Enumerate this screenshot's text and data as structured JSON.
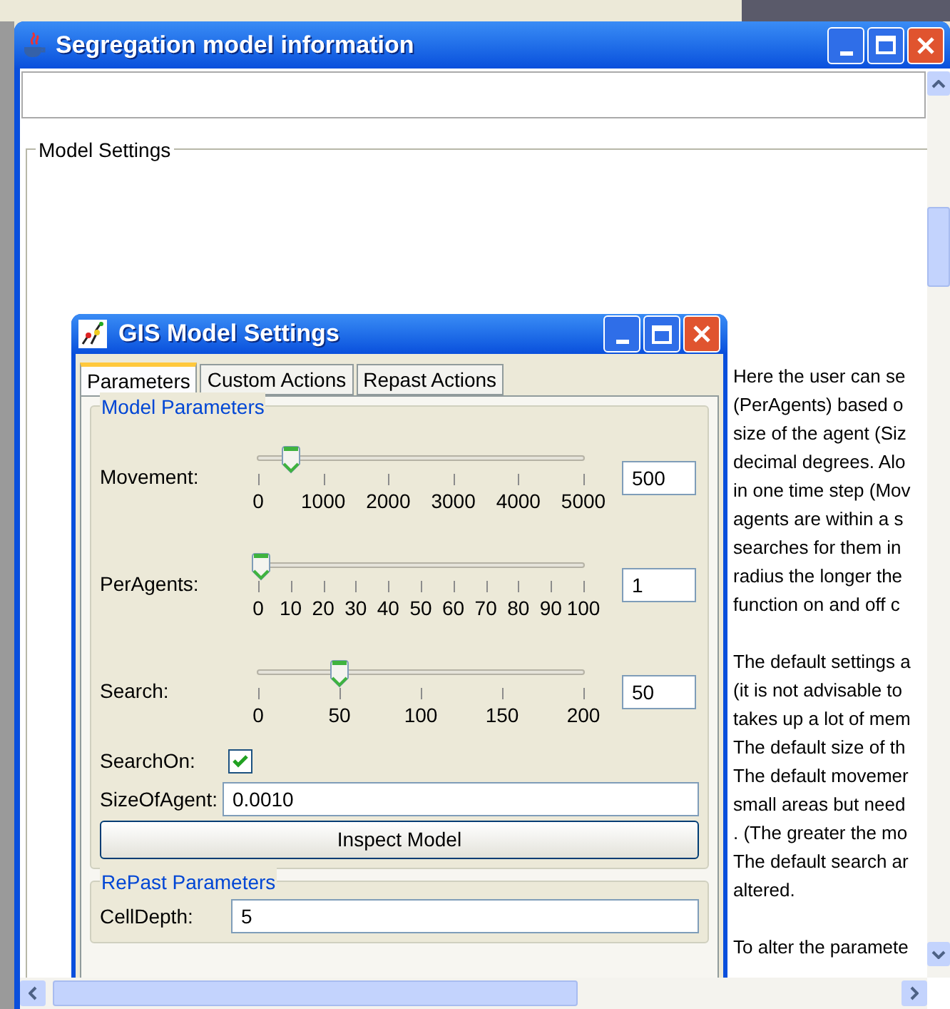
{
  "window": {
    "title": "Segregation model information"
  },
  "group": {
    "title": "Model Settings"
  },
  "dialog": {
    "title": "GIS Model Settings",
    "tabs": [
      {
        "label": "Parameters",
        "selected": true
      },
      {
        "label": "Custom Actions",
        "selected": false
      },
      {
        "label": "Repast Actions",
        "selected": false
      }
    ],
    "model_parameters": {
      "title": "Model Parameters",
      "sliders": [
        {
          "label": "Movement:",
          "level": 0.1,
          "value": "500",
          "ticks": [
            "0",
            "1000",
            "2000",
            "3000",
            "4000",
            "5000"
          ]
        },
        {
          "label": "PerAgents:",
          "level": 0.01,
          "value": "1",
          "ticks": [
            "0",
            "10",
            "20",
            "30",
            "40",
            "50",
            "60",
            "70",
            "80",
            "90",
            "100"
          ]
        },
        {
          "label": "Search:",
          "level": 0.25,
          "value": "50",
          "ticks": [
            "0",
            "50",
            "100",
            "150",
            "200"
          ]
        }
      ],
      "search_on": {
        "label": "SearchOn:",
        "checked": true
      },
      "size_of_agent": {
        "label": "SizeOfAgent:",
        "value": "0.0010"
      },
      "button": "Inspect Model"
    },
    "repast_parameters": {
      "title": "RePast Parameters",
      "cell_depth": {
        "label": "CellDepth:",
        "value": "5"
      }
    }
  },
  "help_text": [
    [
      "Here the user can se",
      "(PerAgents) based o",
      "size of the agent (Siz",
      "decimal degrees. Alo",
      "in one time step (Mov",
      "agents are within a s",
      "searches for them in",
      "radius the longer the",
      "function on and off c"
    ],
    [
      "The default settings a",
      "(it is not advisable to",
      "takes up a lot of mem",
      "The default size of th",
      "The default movemer",
      "small areas but need",
      ". (The greater the mo",
      "The default search ar",
      "altered."
    ],
    [
      "To alter the paramete"
    ]
  ]
}
